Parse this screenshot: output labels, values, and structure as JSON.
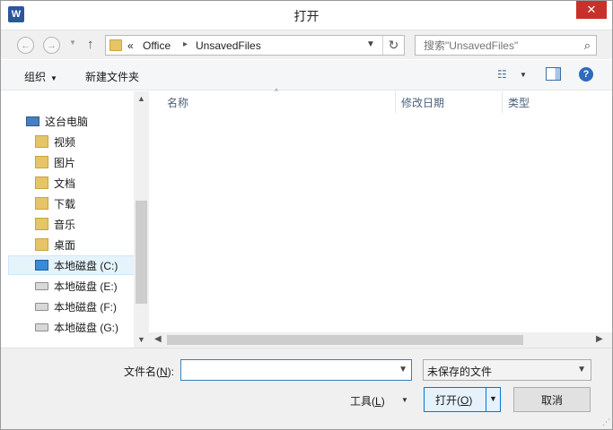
{
  "window": {
    "title": "打开",
    "app_icon_letter": "W",
    "close_glyph": "✕"
  },
  "nav": {
    "back_glyph": "←",
    "forward_glyph": "→",
    "dropdown_glyph": "▼",
    "up_glyph": "↑",
    "refresh_glyph": "↻"
  },
  "address": {
    "overflow": "«",
    "segments": [
      "Office",
      "UnsavedFiles"
    ],
    "separator": "▸"
  },
  "search": {
    "placeholder": "搜索\"UnsavedFiles\"",
    "icon_glyph": "⌕"
  },
  "toolbar": {
    "organize_label": "组织",
    "new_folder_label": "新建文件夹",
    "view_glyph": "☷",
    "help_glyph": "?"
  },
  "sidebar": {
    "items": [
      {
        "label": "这台电脑",
        "icon": "computer-icon"
      },
      {
        "label": "视频",
        "icon": "videos-folder-icon"
      },
      {
        "label": "图片",
        "icon": "pictures-folder-icon"
      },
      {
        "label": "文档",
        "icon": "documents-folder-icon"
      },
      {
        "label": "下载",
        "icon": "downloads-folder-icon"
      },
      {
        "label": "音乐",
        "icon": "music-folder-icon"
      },
      {
        "label": "桌面",
        "icon": "desktop-folder-icon"
      },
      {
        "label": "本地磁盘 (C:)",
        "icon": "windows-drive-icon"
      },
      {
        "label": "本地磁盘 (E:)",
        "icon": "drive-icon"
      },
      {
        "label": "本地磁盘 (F:)",
        "icon": "drive-icon"
      },
      {
        "label": "本地磁盘 (G:)",
        "icon": "drive-icon"
      }
    ]
  },
  "file_list": {
    "columns": [
      "名称",
      "修改日期",
      "类型"
    ],
    "sort_glyph": "^",
    "rows": []
  },
  "scroll": {
    "up": "▲",
    "down": "▼",
    "left": "◀",
    "right": "▶"
  },
  "bottom": {
    "filename_label": "文件名(",
    "filename_key": "N",
    "filename_label_end": "):",
    "filename_value": "",
    "type_selected": "未保存的文件",
    "tools_label": "工具(",
    "tools_key": "L",
    "tools_label_end": ")",
    "open_label": "打开(",
    "open_key": "O",
    "open_label_end": ")",
    "cancel_label": "取消"
  }
}
